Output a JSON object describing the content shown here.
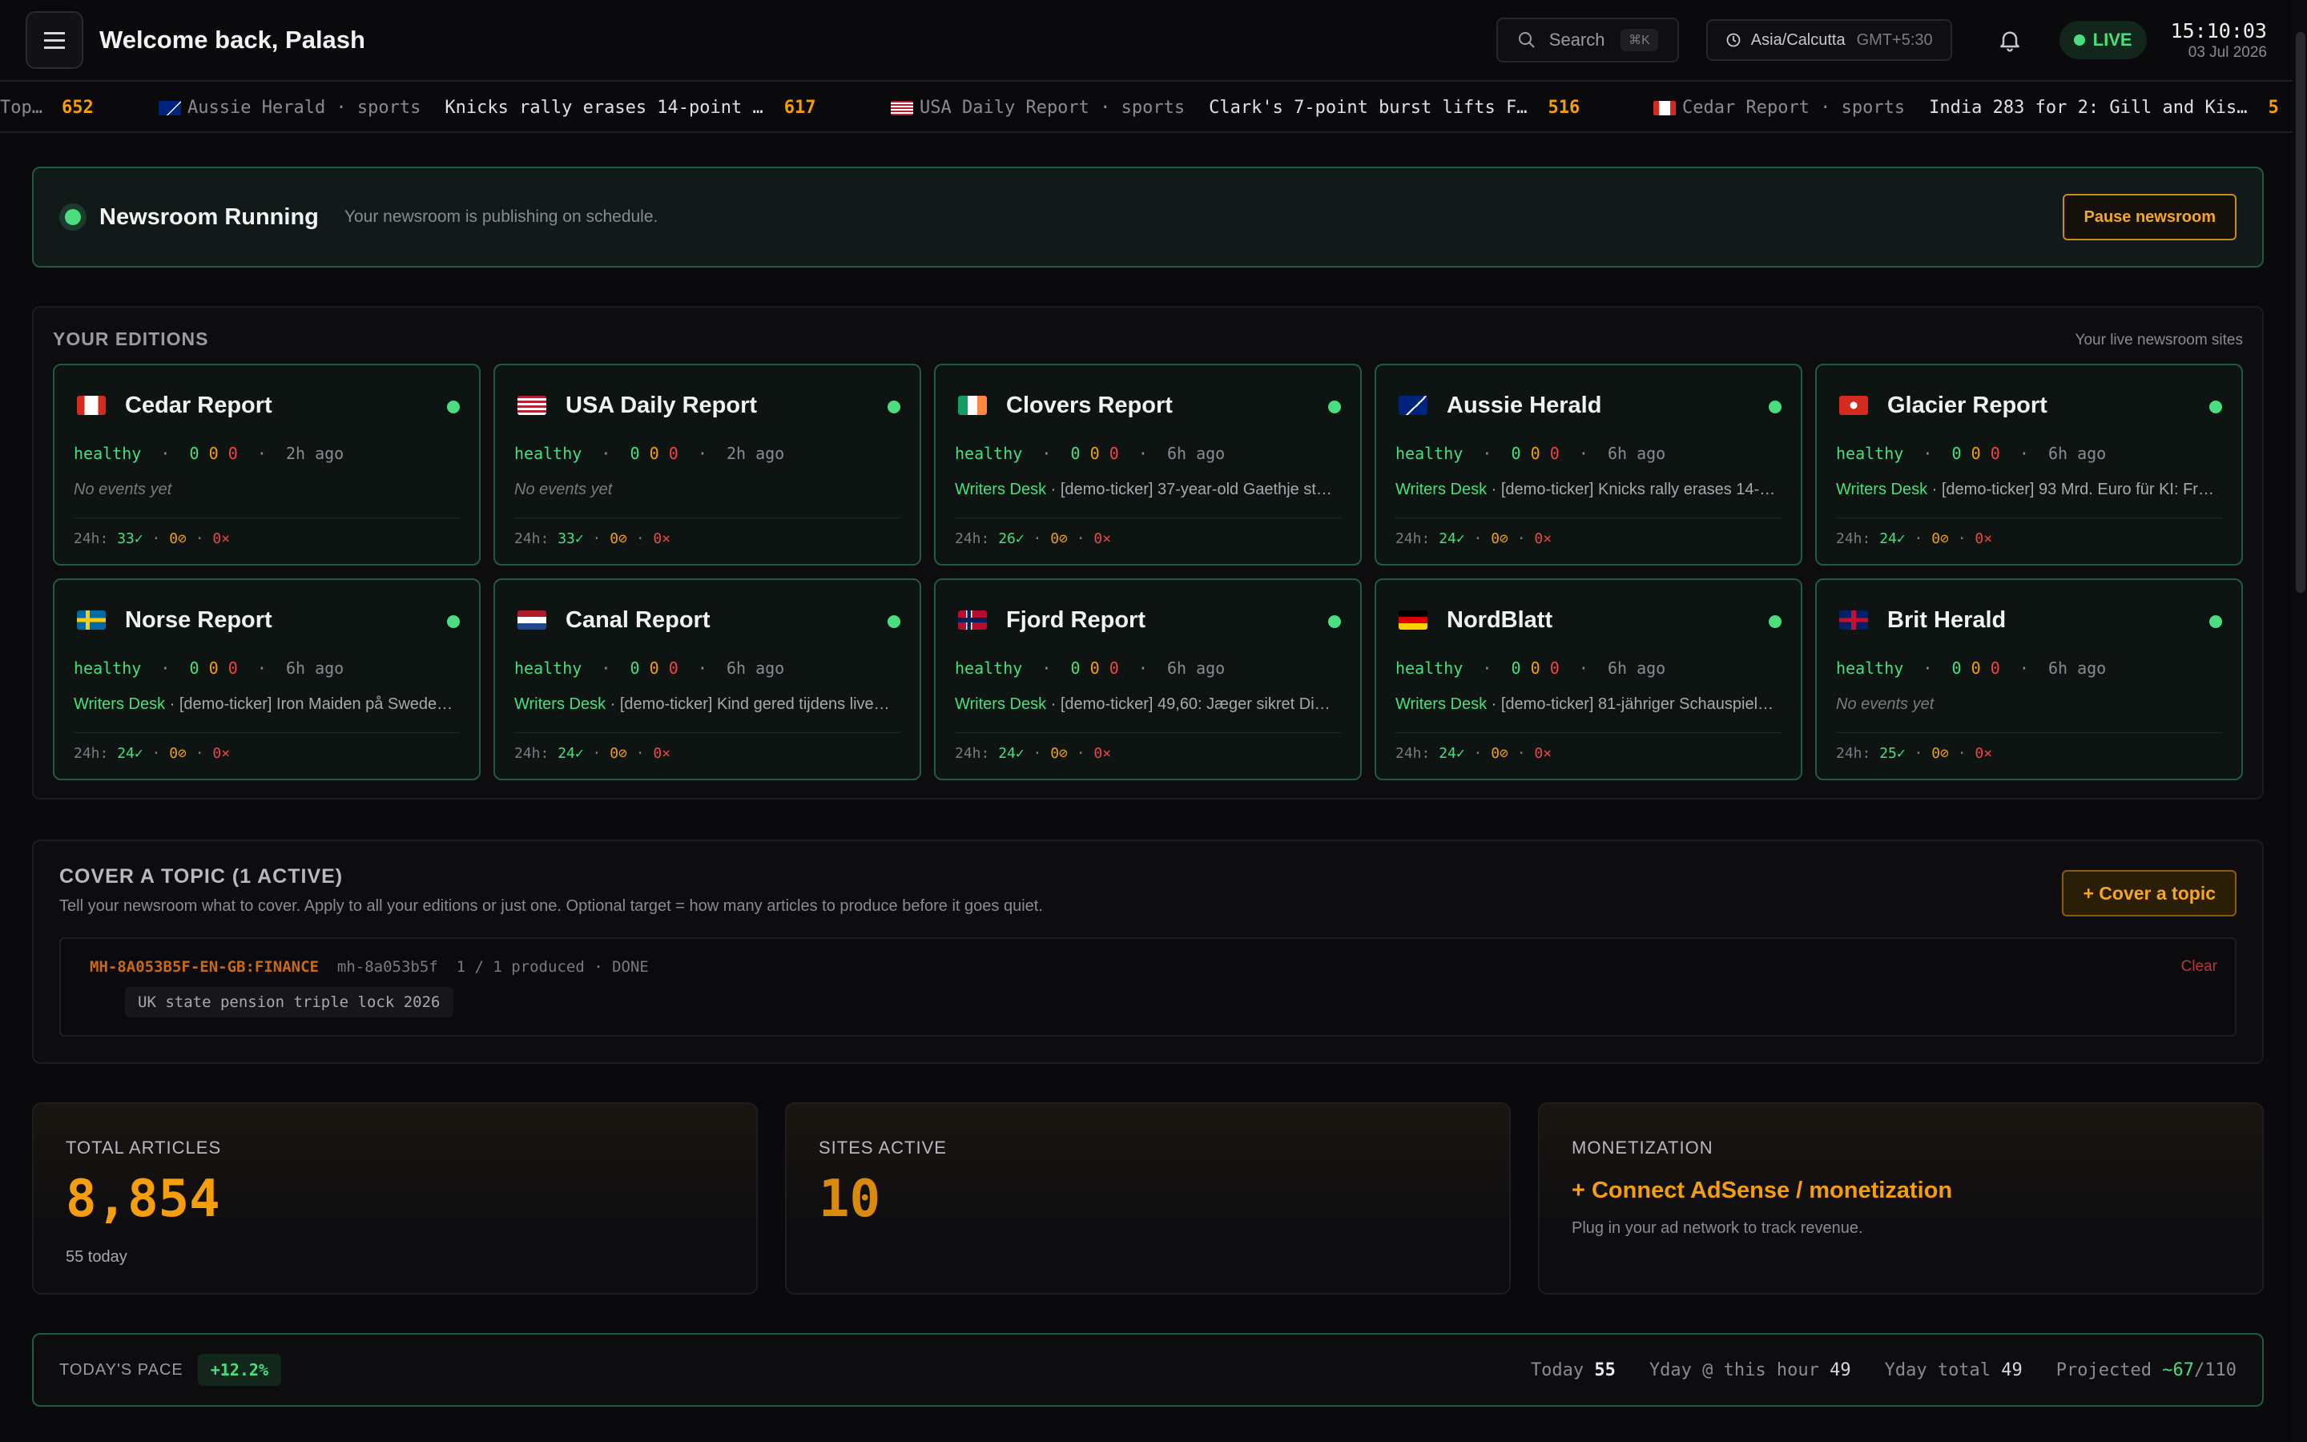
{
  "header": {
    "welcome": "Welcome back, Palash",
    "search_label": "Search",
    "search_shortcut": "⌘K",
    "timezone": "Asia/Calcutta",
    "timezone_offset": "GMT+5:30",
    "live_label": "LIVE",
    "clock_time": "15:10:03",
    "clock_date": "03 Jul 2026"
  },
  "ticker": {
    "items": [
      {
        "source": "Top…",
        "count": "652"
      },
      {
        "flag": "AU",
        "source": "Aussie Herald · sports",
        "headline": "Knicks rally erases 14-point …",
        "count": "617"
      },
      {
        "flag": "US",
        "source": "USA Daily Report · sports",
        "headline": "Clark's 7-point burst lifts F…",
        "count": "516"
      },
      {
        "flag": "CA",
        "source": "Cedar Report · sports",
        "headline": "India 283 for 2: Gill and Kis…",
        "count": "5"
      }
    ]
  },
  "status": {
    "title": "Newsroom Running",
    "subtitle": "Your newsroom is publishing on schedule.",
    "pause_label": "Pause newsroom"
  },
  "editions": {
    "heading": "YOUR EDITIONS",
    "right_label": "Your live newsroom sites",
    "cards": [
      {
        "name": "Cedar Report",
        "flag": "CA",
        "health": "healthy",
        "ago": "2h ago",
        "writer": "",
        "event": "No events yet",
        "ok": "33✓",
        "warn": "0⊘",
        "err": "0×"
      },
      {
        "name": "USA Daily Report",
        "flag": "US",
        "health": "healthy",
        "ago": "2h ago",
        "writer": "",
        "event": "No events yet",
        "ok": "33✓",
        "warn": "0⊘",
        "err": "0×"
      },
      {
        "name": "Clovers Report",
        "flag": "IE",
        "health": "healthy",
        "ago": "6h ago",
        "writer": "Writers Desk",
        "event": " · [demo-ticker] 37-year-old Gaethje st…",
        "ok": "26✓",
        "warn": "0⊘",
        "err": "0×"
      },
      {
        "name": "Aussie Herald",
        "flag": "AU",
        "health": "healthy",
        "ago": "6h ago",
        "writer": "Writers Desk",
        "event": " · [demo-ticker] Knicks rally erases 14-…",
        "ok": "24✓",
        "warn": "0⊘",
        "err": "0×"
      },
      {
        "name": "Glacier Report",
        "flag": "CH",
        "health": "healthy",
        "ago": "6h ago",
        "writer": "Writers Desk",
        "event": " · [demo-ticker] 93 Mrd. Euro für KI: Fr…",
        "ok": "24✓",
        "warn": "0⊘",
        "err": "0×"
      },
      {
        "name": "Norse Report",
        "flag": "SE",
        "health": "healthy",
        "ago": "6h ago",
        "writer": "Writers Desk",
        "event": " · [demo-ticker] Iron Maiden på Swede…",
        "ok": "24✓",
        "warn": "0⊘",
        "err": "0×"
      },
      {
        "name": "Canal Report",
        "flag": "NL",
        "health": "healthy",
        "ago": "6h ago",
        "writer": "Writers Desk",
        "event": " · [demo-ticker] Kind gered tijdens live…",
        "ok": "24✓",
        "warn": "0⊘",
        "err": "0×"
      },
      {
        "name": "Fjord Report",
        "flag": "NO",
        "health": "healthy",
        "ago": "6h ago",
        "writer": "Writers Desk",
        "event": " · [demo-ticker] 49,60: Jæger sikret Di…",
        "ok": "24✓",
        "warn": "0⊘",
        "err": "0×"
      },
      {
        "name": "NordBlatt",
        "flag": "DE",
        "health": "healthy",
        "ago": "6h ago",
        "writer": "Writers Desk",
        "event": " · [demo-ticker] 81-jähriger Schauspiel…",
        "ok": "24✓",
        "warn": "0⊘",
        "err": "0×"
      },
      {
        "name": "Brit Herald",
        "flag": "GB",
        "health": "healthy",
        "ago": "6h ago",
        "writer": "",
        "event": "No events yet",
        "ok": "25✓",
        "warn": "0⊘",
        "err": "0×"
      }
    ]
  },
  "topic": {
    "heading": "COVER A TOPIC (1 ACTIVE)",
    "subtitle": "Tell your newsroom what to cover. Apply to all your editions or just one. Optional target = how many articles to produce before it goes quiet.",
    "cover_label": "+ Cover a topic",
    "item": {
      "id": "MH-8A053B5F-EN-GB:FINANCE",
      "short_id": "mh-8a053b5f",
      "progress": "1 / 1 produced",
      "state": "DONE",
      "query": "UK state pension triple lock 2026",
      "clear_label": "Clear"
    }
  },
  "stats": {
    "total_label": "TOTAL ARTICLES",
    "total_value": "8,854",
    "total_sub": "55 today",
    "sites_label": "SITES ACTIVE",
    "sites_value": "10",
    "monetization_label": "MONETIZATION",
    "monetization_link": "+ Connect AdSense / monetization",
    "monetization_sub": "Plug in your ad network to track revenue."
  },
  "pace": {
    "label": "TODAY'S PACE",
    "change": "+12.2%",
    "today_label": "Today",
    "today_value": "55",
    "yday_hour_label": "Yday @ this hour",
    "yday_hour_value": "49",
    "yday_total_label": "Yday total",
    "yday_total_value": "49",
    "projected_label": "Projected",
    "projected_value": "~67",
    "projected_target": "/110"
  },
  "colors": {
    "accent": "#f59e0b",
    "healthy": "#4ade80",
    "error": "#ef4444",
    "border_ok": "#1f5a42"
  }
}
